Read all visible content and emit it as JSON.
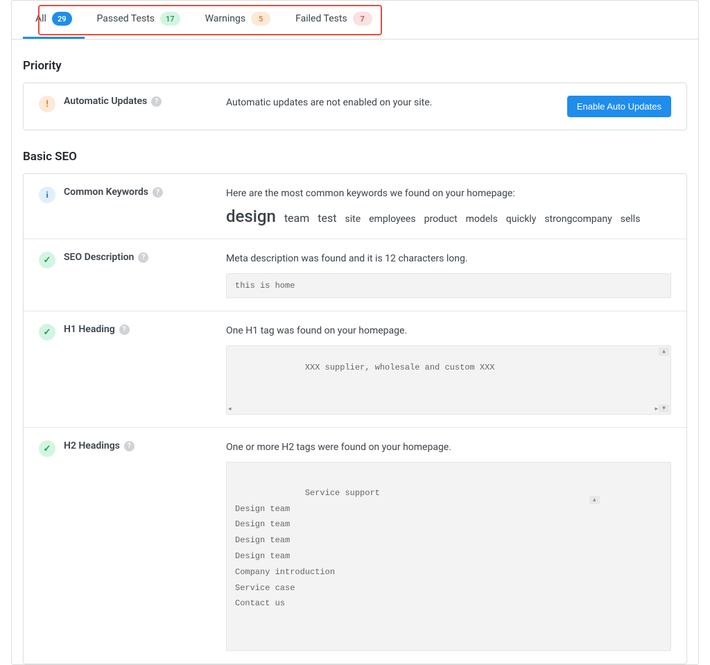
{
  "tabs": {
    "all": {
      "label": "All",
      "count": "29"
    },
    "passed": {
      "label": "Passed Tests",
      "count": "17"
    },
    "warnings": {
      "label": "Warnings",
      "count": "5"
    },
    "failed": {
      "label": "Failed Tests",
      "count": "7"
    }
  },
  "sections": {
    "priority": {
      "title": "Priority"
    },
    "basic_seo": {
      "title": "Basic SEO"
    }
  },
  "priority_row": {
    "title": "Automatic Updates",
    "desc": "Automatic updates are not enabled on your site.",
    "button": "Enable Auto Updates"
  },
  "common_keywords": {
    "title": "Common Keywords",
    "desc": "Here are the most common keywords we found on your homepage:",
    "words": [
      "design",
      "team",
      "test",
      "site",
      "employees",
      "product",
      "models",
      "quickly",
      "strongcompany",
      "sells"
    ]
  },
  "seo_description": {
    "title": "SEO Description",
    "desc": "Meta description was found and it is 12 characters long.",
    "code": "this is home"
  },
  "h1_heading": {
    "title": "H1 Heading",
    "desc": "One H1 tag was found on your homepage.",
    "code": "XXX supplier, wholesale and custom XXX"
  },
  "h2_headings": {
    "title": "H2 Headings",
    "desc": "One or more H2 tags were found on your homepage.",
    "code": "Service support\nDesign team\nDesign team\nDesign team\nDesign team\nCompany introduction\nService case\nContact us"
  }
}
